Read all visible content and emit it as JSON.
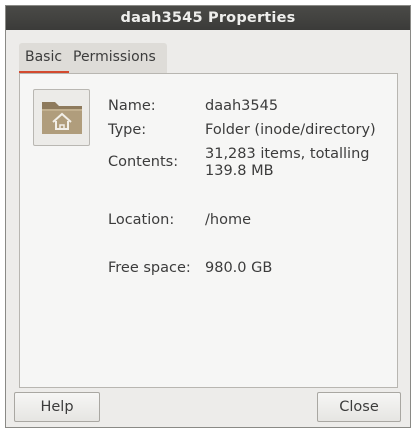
{
  "window": {
    "title": "daah3545 Properties"
  },
  "tabs": [
    {
      "label": "Basic"
    },
    {
      "label": "Permissions"
    }
  ],
  "basic": {
    "icon": "folder-home-icon",
    "name_label": "Name:",
    "name_value": "daah3545",
    "type_label": "Type:",
    "type_value": "Folder (inode/directory)",
    "contents_label": "Contents:",
    "contents_value_line1": "31,283 items, totalling",
    "contents_value_line2": "139.8 MB",
    "location_label": "Location:",
    "location_value": "/home",
    "free_label": "Free space:",
    "free_value": "980.0 GB"
  },
  "buttons": {
    "help": "Help",
    "close": "Close"
  },
  "colors": {
    "titlebar": "#3c3c3a",
    "tab_accent": "#d34a2f",
    "folder": "#a08c6c"
  }
}
